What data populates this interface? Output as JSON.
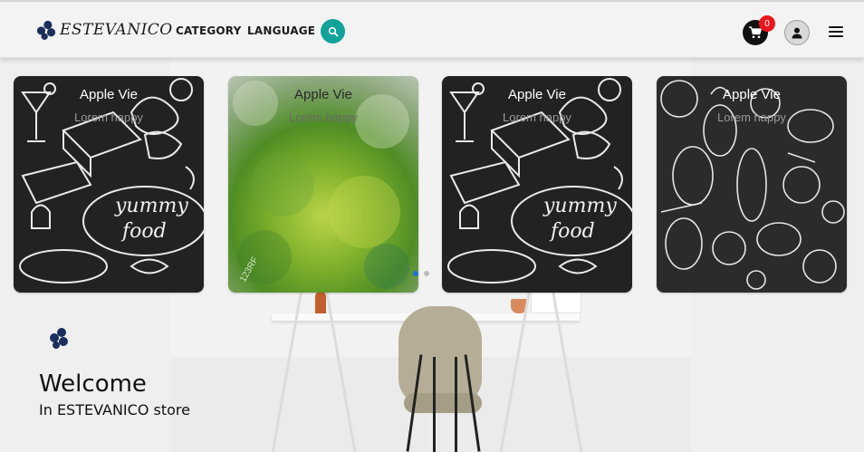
{
  "header": {
    "brand": "ESTEVANICO",
    "nav": [
      {
        "label": "CATEGORY"
      },
      {
        "label": "LANGUAGE"
      }
    ],
    "cart_count": "0",
    "icons": {
      "logo": "clover-logo-icon",
      "search": "search-icon",
      "cart": "cart-icon",
      "user": "user-icon",
      "menu": "hamburger-menu-icon"
    }
  },
  "carousel": {
    "cards": [
      {
        "title": "Apple Vie",
        "subtitle": "Lorem happy",
        "style": "chalk-food"
      },
      {
        "title": "Apple Vie",
        "subtitle": "Lorem happy",
        "style": "green-texture",
        "watermark": "123RF"
      },
      {
        "title": "Apple Vie",
        "subtitle": "Lorem happy",
        "style": "chalk-food"
      },
      {
        "title": "Apple Vie",
        "subtitle": "Lorem happy",
        "style": "chalk-vegetables"
      }
    ],
    "pagination": {
      "total": 2,
      "active": 1
    },
    "doodle_text": [
      "yummy",
      "food"
    ]
  },
  "welcome": {
    "title": "Welcome",
    "subtitle": "In ESTEVANICO store"
  },
  "colors": {
    "accent_teal": "#11a39a",
    "badge_red": "#e8171d",
    "logo_navy": "#1c2f5c",
    "active_dot": "#1e73d6"
  }
}
